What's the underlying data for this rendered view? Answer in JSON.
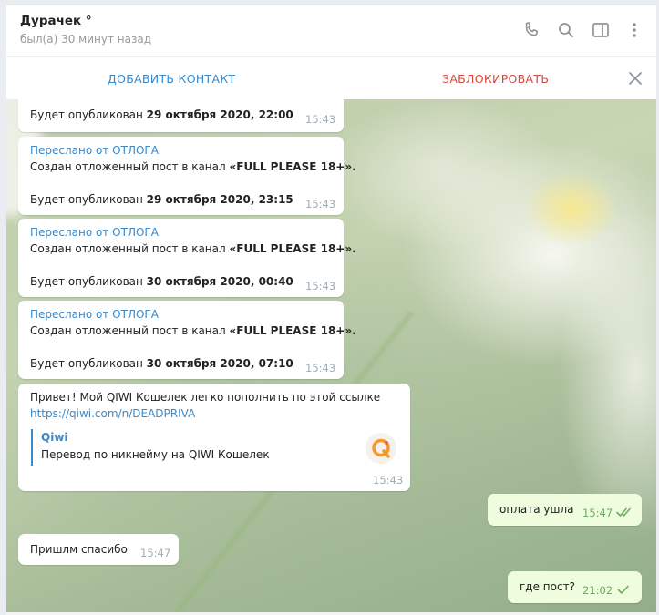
{
  "header": {
    "title": "Дурачек °",
    "status": "был(а) 30 минут назад",
    "icons": [
      "phone-icon",
      "search-icon",
      "sidebar-icon",
      "more-icon"
    ]
  },
  "action_bar": {
    "add_contact": "ДОБАВИТЬ КОНТАКТ",
    "block": "ЗАБЛОКИРОВАТЬ"
  },
  "messages": [
    {
      "partial_line": "Будет опубликован ",
      "partial_date": "29 октября 2020, 22:00",
      "time": "15:43"
    },
    {
      "forwarded": "Переслано от ОТЛОГА",
      "text_prefix": "Создан отложенный пост в канал ",
      "channel": "«FULL PLEASE 18+».",
      "published_prefix": "Будет опубликован ",
      "published_date": "29 октября 2020, 23:15",
      "time": "15:43"
    },
    {
      "forwarded": "Переслано от ОТЛОГА",
      "text_prefix": "Создан отложенный пост в канал ",
      "channel": "«FULL PLEASE 18+».",
      "published_prefix": "Будет опубликован ",
      "published_date": "30 октября 2020, 00:40",
      "time": "15:43"
    },
    {
      "forwarded": "Переслано от ОТЛОГА",
      "text_prefix": "Создан отложенный пост в канал ",
      "channel": "«FULL PLEASE 18+».",
      "published_prefix": "Будет опубликован ",
      "published_date": "30 октября 2020, 07:10",
      "time": "15:43"
    },
    {
      "text": "Привет! Мой QIWI Кошелек легко пополнить по этой ссылке",
      "link": "https://qiwi.com/n/DEADPRIVA",
      "preview_site": "Qiwi",
      "preview_desc": "Перевод по никнейму на QIWI Кошелек",
      "time": "15:43"
    },
    {
      "text": "оплата ушла",
      "time": "15:47",
      "status": "read"
    },
    {
      "text": "Пришлм спасибо",
      "time": "15:47"
    },
    {
      "text": "где пост?",
      "time": "21:02",
      "status": "sent"
    }
  ],
  "colors": {
    "accent": "#3a89c9",
    "danger": "#d24a3c",
    "outgoing_bubble": "#effdde",
    "check": "#6cad5f",
    "qiwi_orange": "#f39a2b"
  }
}
